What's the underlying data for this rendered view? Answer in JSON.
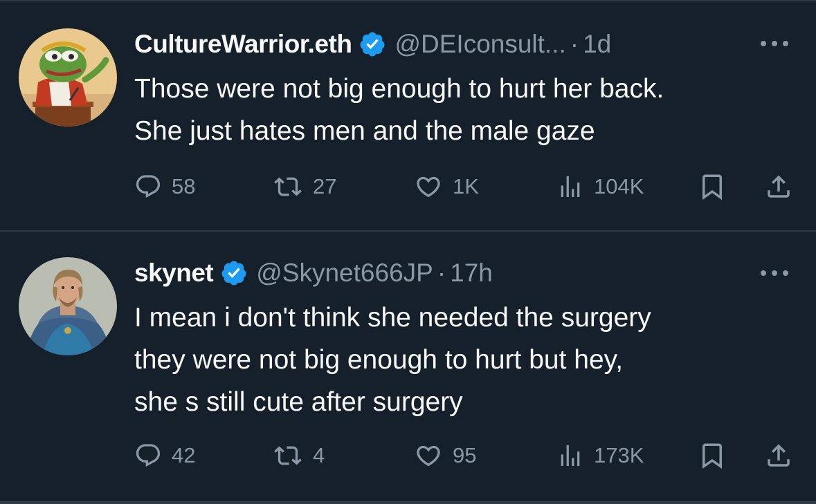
{
  "colors": {
    "background": "#15202b",
    "text_primary": "#f7f9f9",
    "text_secondary": "#8b98a5",
    "verified_blue": "#1d9bf0",
    "divider": "#2f3b47"
  },
  "tweets": [
    {
      "display_name": "CultureWarrior.eth",
      "verified": true,
      "handle": "@DEIconsult...",
      "separator": "·",
      "time": "1d",
      "avatar_icon": "frog-orator-avatar",
      "text_lines": [
        "Those were not big enough to hurt her back.",
        "She just hates men and the male gaze"
      ],
      "stats": {
        "replies": "58",
        "reposts": "27",
        "likes": "1K",
        "views": "104K"
      }
    },
    {
      "display_name": "skynet",
      "verified": true,
      "handle": "@Skynet666JP",
      "separator": "·",
      "time": "17h",
      "avatar_icon": "medieval-man-avatar",
      "text_lines": [
        "I mean i don't think she needed the surgery",
        "they were not big enough to hurt but hey,",
        "she s still cute after surgery"
      ],
      "stats": {
        "replies": "42",
        "reposts": "4",
        "likes": "95",
        "views": "173K"
      }
    }
  ]
}
